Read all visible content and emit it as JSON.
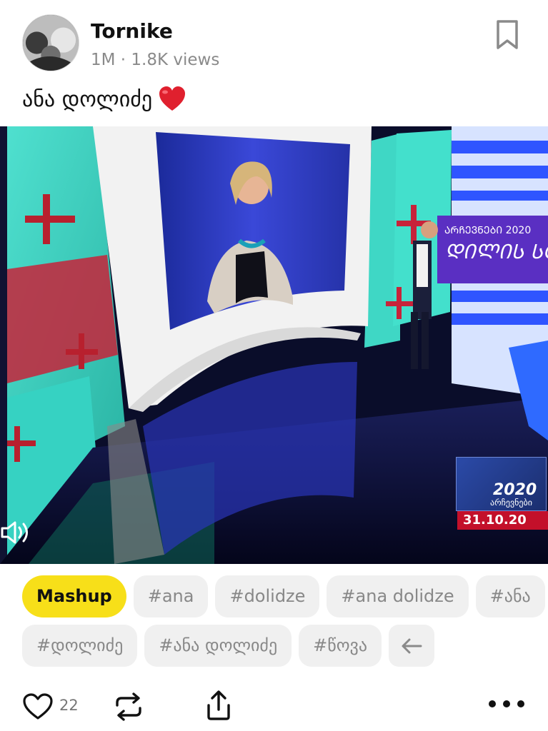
{
  "post": {
    "author": "Tornike",
    "meta": "1M · 1.8K views",
    "caption": "ანა დოლიძე",
    "avatar_icon": "user-avatar"
  },
  "video": {
    "overlay_logo": "2020",
    "overlay_logo_sub": "არჩევნები",
    "overlay_date": "31.10.20",
    "sound_icon": "speaker-icon"
  },
  "tags": {
    "row1": [
      "Mashup",
      "#ana",
      "#dolidze",
      "#ana dolidze",
      "#ანა"
    ],
    "row2": [
      "#დოლიძე",
      "#ანა დოლიძე",
      "#წოვა"
    ],
    "active_color": "#f7df19"
  },
  "actions": {
    "like_count": "22"
  }
}
